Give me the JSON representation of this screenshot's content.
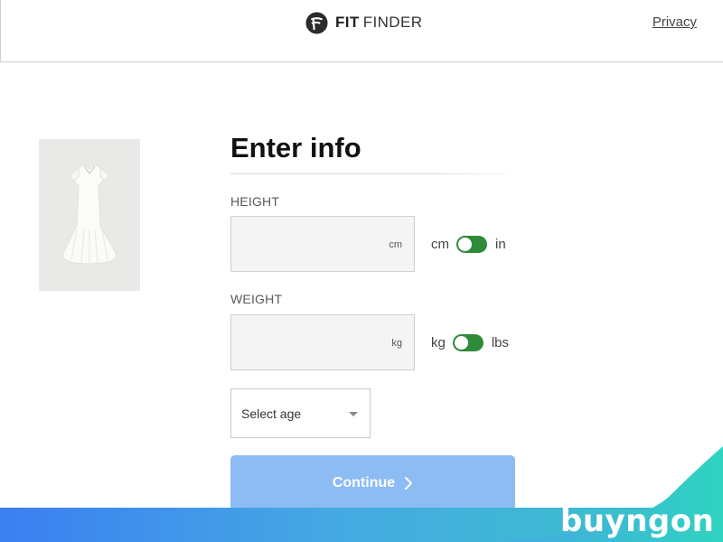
{
  "header": {
    "logo_bold": "FIT",
    "logo_light": "FINDER",
    "privacy_label": "Privacy"
  },
  "product": {
    "image_icon": "white-dress-image"
  },
  "form": {
    "title": "Enter info",
    "height": {
      "label": "HEIGHT",
      "value": "",
      "unit": "cm",
      "toggle_left": "cm",
      "toggle_right": "in"
    },
    "weight": {
      "label": "WEIGHT",
      "value": "",
      "unit": "kg",
      "toggle_left": "kg",
      "toggle_right": "lbs"
    },
    "age_select": {
      "selected": "Select age"
    },
    "continue_label": "Continue"
  },
  "footer": {
    "brand": "buyngon"
  },
  "colors": {
    "toggle_green": "#2e8b3a",
    "continue_button": "#8cbcf2",
    "banner_start": "#3b7ff2",
    "banner_end": "#39c5c8"
  }
}
